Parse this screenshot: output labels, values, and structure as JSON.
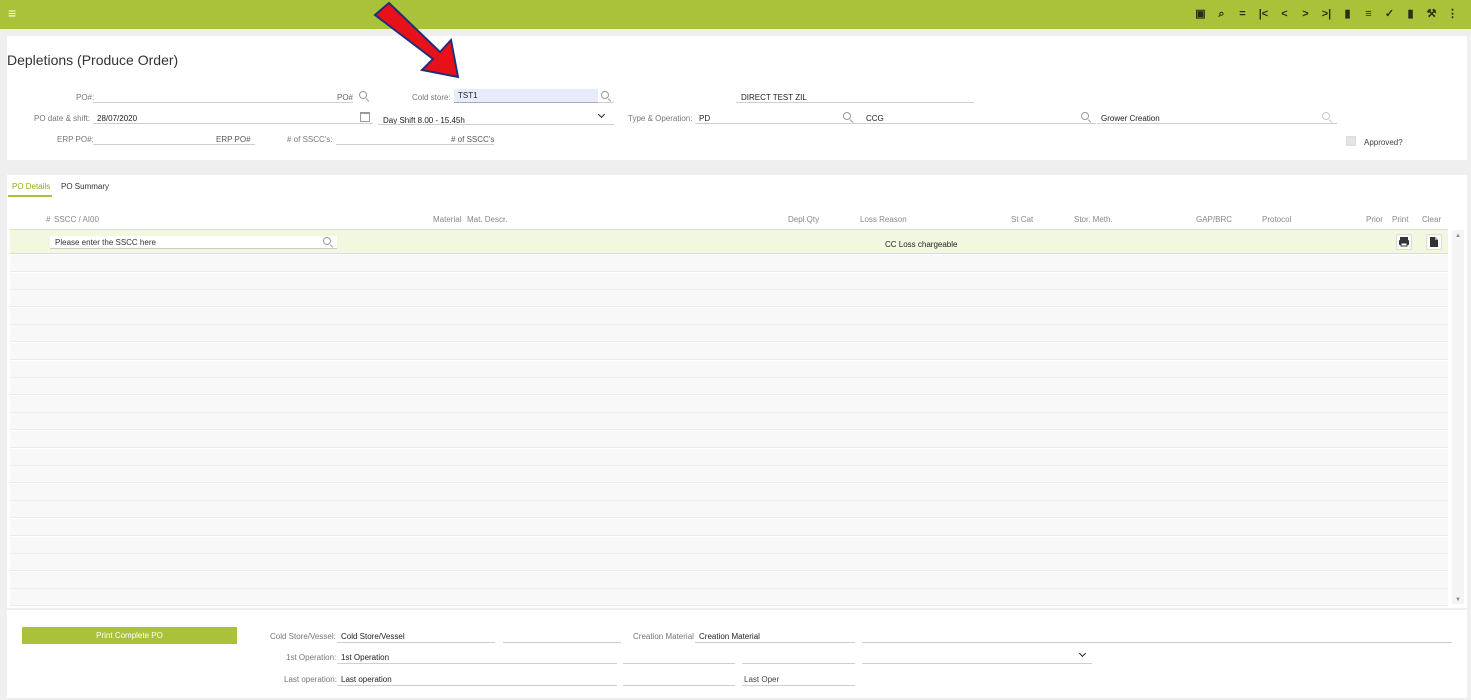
{
  "page_title": "Depletions (Produce Order)",
  "toolbar": {
    "icons": [
      "calendar-icon",
      "search-icon",
      "minus-icon",
      "first-icon",
      "prev-icon",
      "next-icon",
      "last-icon",
      "document-icon",
      "list-icon",
      "check-icon",
      "trash-icon",
      "wrench-icon",
      "more-icon"
    ],
    "glyphs": [
      "▣",
      "⌕",
      "=",
      "|<",
      "<",
      ">",
      ">|",
      "▮",
      "≡",
      "✓",
      "▮",
      "⚒",
      "⋮"
    ]
  },
  "header": {
    "po_label": "PO#:",
    "po_search_label": "PO#",
    "cold_store_label": "Cold store:",
    "cold_store_value": "TST1",
    "cold_store_desc": "DIRECT TEST ZIL",
    "po_date_label": "PO date & shift:",
    "po_date_value": "28/07/2020",
    "shift_value": "Day Shift 8.00 - 15.45h",
    "type_operation_label": "Type & Operation:",
    "type_value": "PD",
    "operation_value": "CCG",
    "operation_desc": "Grower Creation",
    "erp_po_label": "ERP PO#:",
    "erp_po_right_label": "ERP PO#",
    "sscc_count_label": "# of SSCC's:",
    "sscc_count_right_label": "# of SSCC's",
    "approved_label": "Approved?"
  },
  "tabs": [
    {
      "label": "PO Details"
    },
    {
      "label": "PO Summary"
    }
  ],
  "grid": {
    "columns": [
      "#",
      "SSCC / AI00",
      "Material",
      "Mat. Descr.",
      "Depl.Qty",
      "Loss Reason",
      "St Cat",
      "Stor. Meth.",
      "GAP/BRC",
      "Protocol",
      "Prior",
      "Print",
      "Clear"
    ],
    "sscc_placeholder": "Please enter the SSCC here",
    "first_row_loss_reason": "CC Loss chargeable",
    "scroll_up": "▲",
    "scroll_down": "▼"
  },
  "footer": {
    "print_button": "Print Complete PO",
    "cold_store_vessel_label": "Cold Store/Vessel:",
    "cold_store_vessel_value": "Cold Store/Vessel",
    "creation_material_label": "Creation Material",
    "creation_material_value": "Creation Material",
    "first_operation_label": "1st Operation:",
    "first_operation_value": "1st Operation",
    "last_operation_label": "Last operation:",
    "last_operation_value": "Last operation",
    "last_oper_value": "Last Oper"
  },
  "colors": {
    "accent": "#a9c23a",
    "arrow": "#e8111a",
    "arrow_outline": "#1f2f7a"
  }
}
